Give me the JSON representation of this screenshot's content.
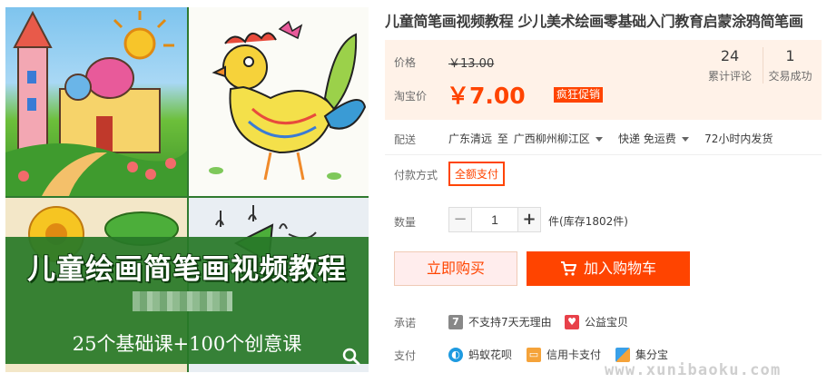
{
  "product": {
    "title": "儿童简笔画视频教程 少儿美术绘画零基础入门教育启蒙涂鸦简笔画",
    "image_banner_title": "儿童绘画简笔画视频教程",
    "image_banner_subtitle": "25个基础课+100个创意课"
  },
  "price": {
    "price_label": "价格",
    "original_price": "￥13.00",
    "taobao_label": "淘宝价",
    "sale_price": "￥7.00",
    "promo_badge": "疯狂促销",
    "reviews_count": "24",
    "reviews_label": "累计评论",
    "sales_count": "1",
    "sales_label": "交易成功"
  },
  "shipping": {
    "label": "配送",
    "from": "广东清远",
    "to_word": "至",
    "to": "广西柳州柳江区",
    "method": "快递 免运费",
    "dispatch": "72小时内发货"
  },
  "payment_method": {
    "label": "付款方式",
    "option": "全额支付"
  },
  "quantity": {
    "label": "数量",
    "minus": "−",
    "value": "1",
    "plus": "+",
    "stock": "件(库存1802件)"
  },
  "actions": {
    "buy_now": "立即购买",
    "add_to_cart": "加入购物车"
  },
  "promise": {
    "label": "承诺",
    "items": [
      {
        "icon_text": "7",
        "text": "不支持7天无理由"
      },
      {
        "icon_text": "",
        "text": "公益宝贝"
      }
    ]
  },
  "pay": {
    "label": "支付",
    "items": [
      {
        "text": "蚂蚁花呗"
      },
      {
        "text": "信用卡支付"
      },
      {
        "text": "集分宝"
      }
    ]
  },
  "watermark": "www.xunibaoku.com",
  "colors": {
    "accent": "#ff4400",
    "price_bg": "#fff2e8"
  }
}
